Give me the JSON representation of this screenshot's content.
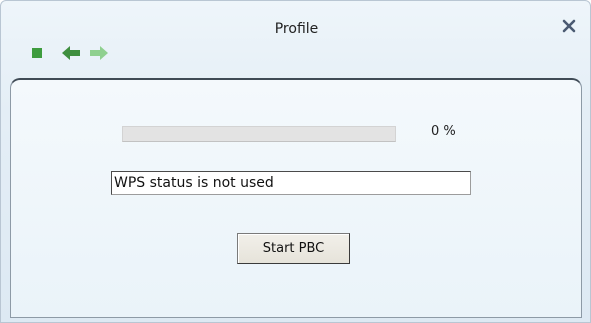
{
  "window": {
    "title": "Profile"
  },
  "toolbar": {
    "stop_icon": "stop-icon",
    "back_icon": "back-arrow-icon",
    "forward_icon": "forward-arrow-icon",
    "icon_color": "#4aa84a",
    "icon_color_disabled": "#8fd08f"
  },
  "wps": {
    "progress_percent": 0,
    "progress_label": "0 %",
    "status_text": "WPS status is not used",
    "start_button_label": "Start PBC"
  }
}
